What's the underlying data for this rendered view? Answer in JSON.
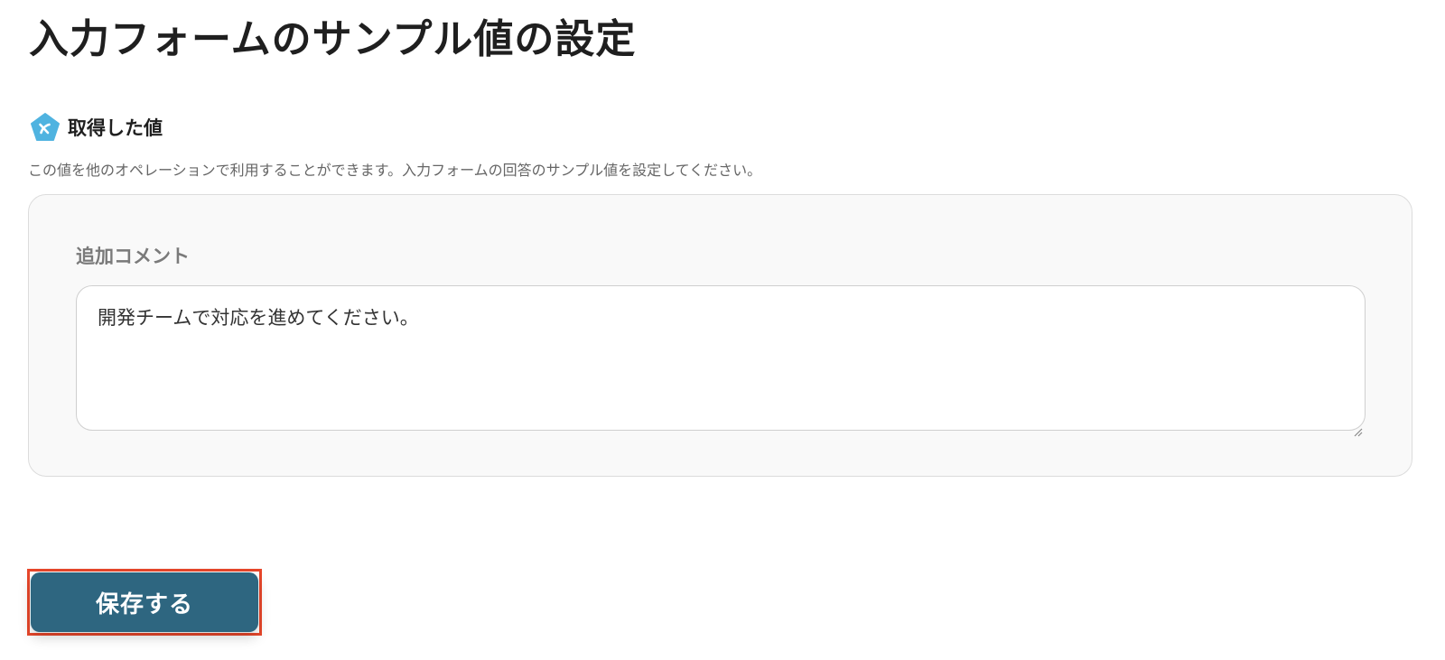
{
  "page": {
    "title": "入力フォームのサンプル値の設定"
  },
  "section": {
    "label": "取得した値",
    "icon": "yoom-pentagon-icon",
    "icon_color": "#4fb3e0",
    "description": "この値を他のオペレーションで利用することができます。入力フォームの回答のサンプル値を設定してください。"
  },
  "form": {
    "field_label": "追加コメント",
    "field_value": "開発チームで対応を進めてください。"
  },
  "actions": {
    "save_label": "保存する",
    "save_color": "#2e6680",
    "highlight_color": "#e8472b"
  }
}
